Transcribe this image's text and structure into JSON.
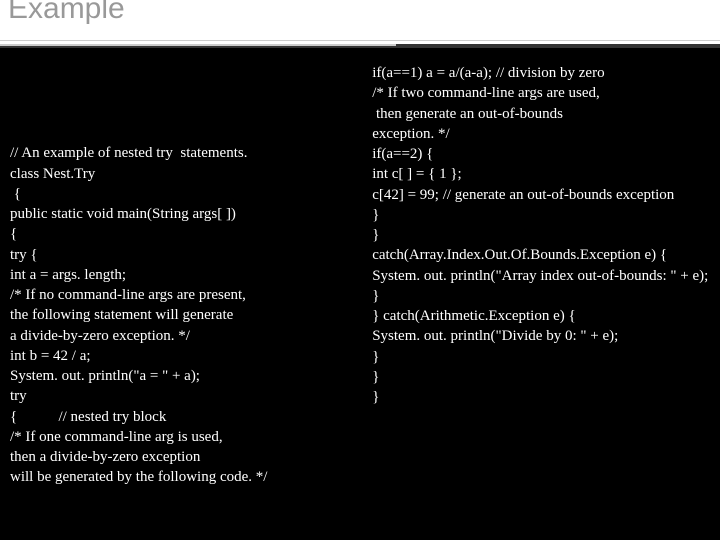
{
  "title": "Example",
  "left_lines": [
    "",
    "// An example of nested try  statements.",
    "class Nest.Try",
    " {",
    "public static void main(String args[ ])",
    "{",
    "try {",
    "int a = args. length;",
    "/* If no command-line args are present,",
    "the following statement will generate",
    "a divide-by-zero exception. */",
    "int b = 42 / a;",
    "System. out. println(\"a = \" + a);",
    "try",
    "{           // nested try block",
    "/* If one command-line arg is used,",
    "then a divide-by-zero exception",
    "will be generated by the following code. */"
  ],
  "right_lines": [
    "if(a==1) a = a/(a-a); // division by zero",
    "/* If two command-line args are used,",
    " then generate an out-of-bounds",
    "exception. */",
    "if(a==2) {",
    "int c[ ] = { 1 };",
    "c[42] = 99; // generate an out-of-bounds exception",
    "}",
    "}",
    "catch(Array.Index.Out.Of.Bounds.Exception e) {",
    "System. out. println(\"Array index out-of-bounds: \" + e);",
    "}",
    "} catch(Arithmetic.Exception e) {",
    "System. out. println(\"Divide by 0: \" + e);",
    "}",
    "}",
    "}"
  ]
}
